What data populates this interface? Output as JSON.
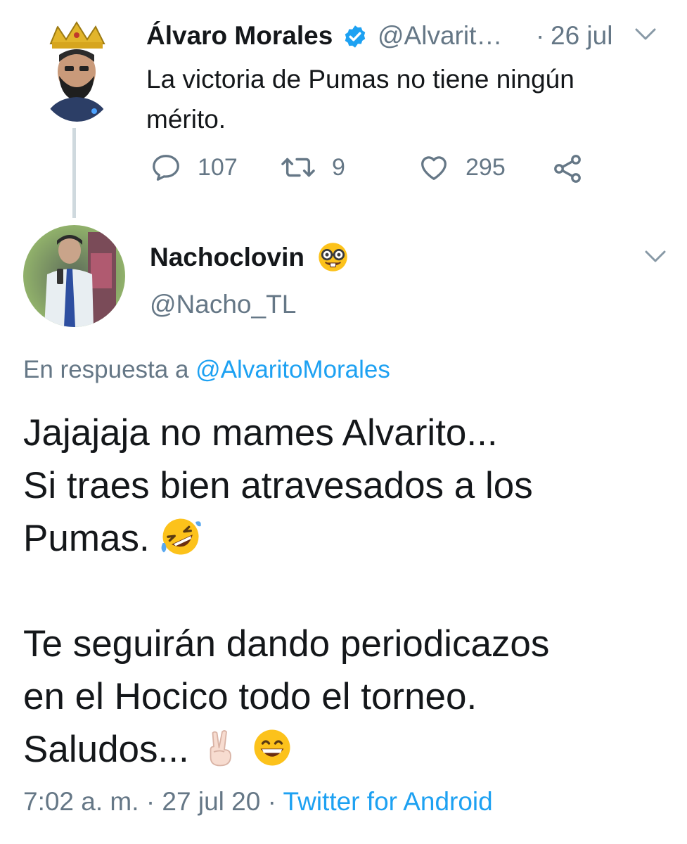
{
  "parent_tweet": {
    "author_name": "Álvaro Morales",
    "handle": "@Alvarit…",
    "separator": "·",
    "date": "26 jul",
    "text_line1": "La victoria de Pumas no tiene ningún",
    "text_line2": "mérito.",
    "replies": "107",
    "retweets": "9",
    "likes": "295",
    "icons": [
      "verified-badge-icon",
      "chevron-down-icon",
      "reply-icon",
      "retweet-icon",
      "like-icon",
      "share-icon"
    ]
  },
  "reply_tweet": {
    "author_name": "Nachoclovin",
    "name_emoji": "nerd-face",
    "handle": "@Nacho_TL",
    "in_reply_prefix": "En respuesta a",
    "in_reply_handle": "@AlvaritoMorales",
    "lines": [
      "Jajajaja no mames Alvarito...",
      "Si traes bien atravesados a los",
      "Pumas."
    ],
    "lines2": [
      "Te seguirán dando periodicazos",
      "en el Hocico todo el torneo.",
      "Saludos..."
    ],
    "time": "7:02 a. m.",
    "sep1": "·",
    "date": "27 jul 20",
    "sep2": "·",
    "source": "Twitter for Android"
  },
  "colors": {
    "text": "#14171a",
    "muted": "#657786",
    "link": "#1da1f2",
    "thread_line": "#cfd9de"
  }
}
